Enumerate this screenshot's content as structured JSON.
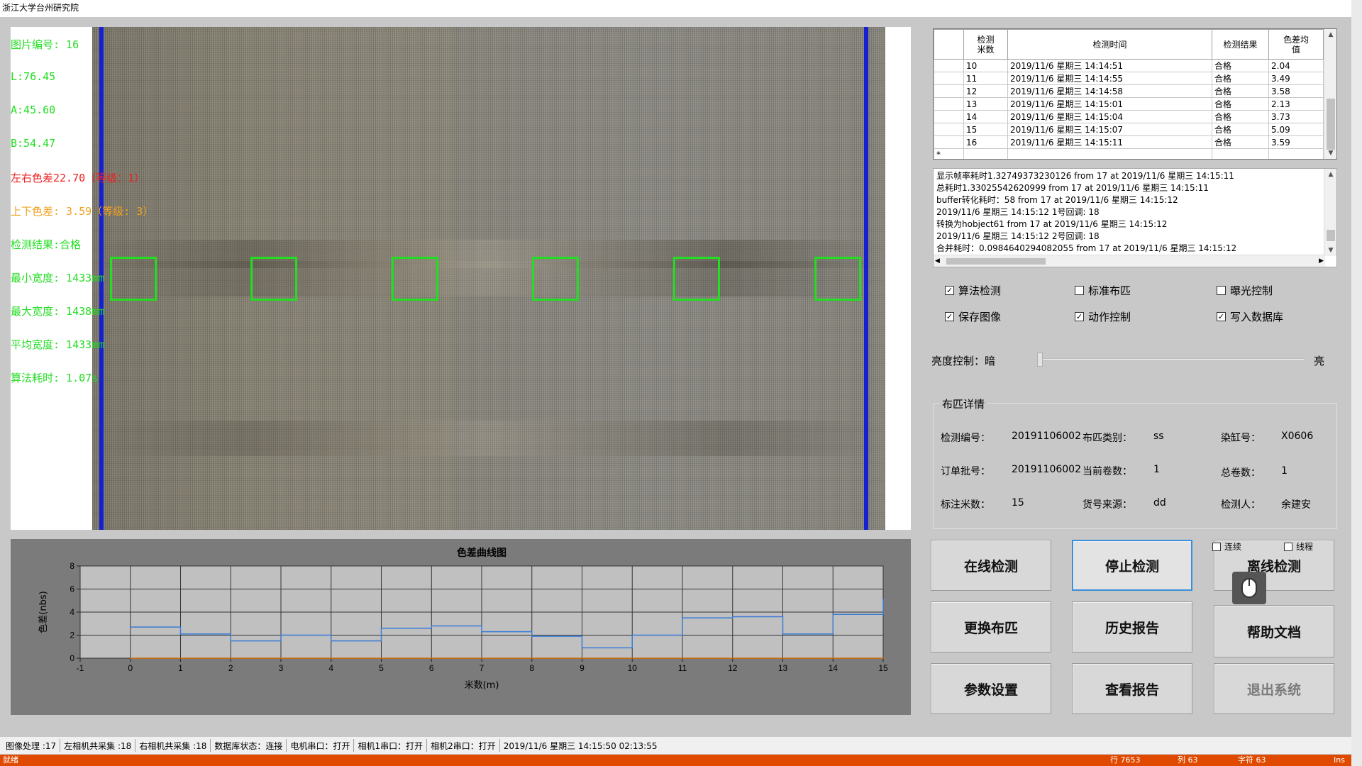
{
  "window": {
    "title": "浙江大学台州研究院"
  },
  "overlay": {
    "lines": [
      {
        "text": "图片编号: 16",
        "color": "#22dd22"
      },
      {
        "text": "L:76.45",
        "color": "#22dd22"
      },
      {
        "text": "A:45.60",
        "color": "#22dd22"
      },
      {
        "text": "B:54.47",
        "color": "#22dd22"
      },
      {
        "text": "左右色差22.70（等级：1）",
        "color": "#ee2222"
      },
      {
        "text": "上下色差: 3.59（等级: 3）",
        "color": "#f0a020"
      },
      {
        "text": "检测结果:合格",
        "color": "#22dd22"
      },
      {
        "text": "最小宽度: 1433mm",
        "color": "#22dd22"
      },
      {
        "text": "最大宽度: 1438mm",
        "color": "#22dd22"
      },
      {
        "text": "平均宽度: 1433mm",
        "color": "#22dd22"
      },
      {
        "text": "算法耗时: 1.07s",
        "color": "#22dd22"
      }
    ]
  },
  "chart_data": {
    "type": "line",
    "title": "色差曲线图",
    "xlabel": "米数(m)",
    "ylabel": "色差(nbs)",
    "xlim": [
      -1,
      15
    ],
    "ylim": [
      0,
      8
    ],
    "xticks": [
      "-1",
      "0",
      "1",
      "2",
      "3",
      "4",
      "5",
      "6",
      "7",
      "8",
      "9",
      "10",
      "11",
      "12",
      "13",
      "14",
      "15"
    ],
    "yticks": [
      "0",
      "2",
      "4",
      "6",
      "8"
    ],
    "grid": true,
    "series": [
      {
        "color": "#3a7bd5",
        "step": true,
        "x": [
          0,
          1,
          2,
          3,
          4,
          5,
          6,
          7,
          8,
          9,
          10,
          11,
          12,
          13,
          14,
          15
        ],
        "values": [
          2.7,
          2.1,
          1.5,
          2.0,
          1.5,
          2.6,
          2.8,
          2.3,
          1.9,
          0.9,
          2.0,
          3.5,
          3.6,
          2.1,
          3.8,
          5.1
        ]
      },
      {
        "color": "#d06a00",
        "step": false,
        "x": [
          0,
          15
        ],
        "values": [
          0,
          0
        ]
      }
    ]
  },
  "grid": {
    "headers": [
      "检测\n米数",
      "检测时间",
      "检测结果",
      "色差均\n值"
    ],
    "rows": [
      [
        "10",
        "2019/11/6 星期三 14:14:51",
        "合格",
        "2.04"
      ],
      [
        "11",
        "2019/11/6 星期三 14:14:55",
        "合格",
        "3.49"
      ],
      [
        "12",
        "2019/11/6 星期三 14:14:58",
        "合格",
        "3.58"
      ],
      [
        "13",
        "2019/11/6 星期三 14:15:01",
        "合格",
        "2.13"
      ],
      [
        "14",
        "2019/11/6 星期三 14:15:04",
        "合格",
        "3.73"
      ],
      [
        "15",
        "2019/11/6 星期三 14:15:07",
        "合格",
        "5.09"
      ],
      [
        "16",
        "2019/11/6 星期三 14:15:11",
        "合格",
        "3.59"
      ]
    ],
    "new_row_marker": "*"
  },
  "log": {
    "lines": [
      "显示帧率耗时1.32749373230126  from 17  at  2019/11/6 星期三 14:15:11",
      "总耗时1.33025542620999  from 17  at  2019/11/6 星期三 14:15:11",
      "buffer转化耗时：58  from 17  at  2019/11/6 星期三 14:15:12",
      "2019/11/6 星期三 14:15:12 1号回调: 18",
      "转换为hobject61  from 17  at  2019/11/6 星期三 14:15:12",
      "2019/11/6 星期三 14:15:12 2号回调: 18",
      "合并耗时：0.0984640294082055  from 17  at  2019/11/6 星期三 14:15:12"
    ]
  },
  "options": {
    "algo_detect": {
      "label": "算法检测",
      "checked": true
    },
    "std_cloth": {
      "label": "标准布匹",
      "checked": false
    },
    "exposure": {
      "label": "曝光控制",
      "checked": false
    },
    "save_image": {
      "label": "保存图像",
      "checked": true
    },
    "motion": {
      "label": "动作控制",
      "checked": true
    },
    "write_db": {
      "label": "写入数据库",
      "checked": true
    }
  },
  "brightness": {
    "label": "亮度控制：暗",
    "max_label": "亮",
    "level": 0.0
  },
  "details": {
    "legend": "布匹详情",
    "fields": {
      "detect_no_label": "检测编号：",
      "detect_no": "20191106002",
      "cloth_type_label": "布匹类别：",
      "cloth_type": "ss",
      "dye_no_label": "染缸号：",
      "dye_no": "X0606",
      "order_no_label": "订单批号：",
      "order_no": "20191106002",
      "cur_roll_label": "当前卷数：",
      "cur_roll": "1",
      "total_roll_label": "总卷数：",
      "total_roll": "1",
      "meters_label": "标注米数：",
      "meters": "15",
      "source_label": "货号来源：",
      "source": "dd",
      "inspector_label": "检测人：",
      "inspector": "余建安"
    }
  },
  "buttons": {
    "online": "在线检测",
    "stop": "停止检测",
    "offline": "离线检测",
    "change": "更换布匹",
    "history": "历史报告",
    "help": "帮助文档",
    "params": "参数设置",
    "view": "查看报告",
    "exit": "退出系统"
  },
  "small_checks": {
    "continuous": "连续",
    "thread": "线程"
  },
  "status": {
    "items": [
      "图像处理 :17",
      "左相机共采集 :18",
      "右相机共采集 :18",
      "数据库状态：连接",
      "电机串口：打开",
      "相机1串口：打开",
      "相机2串口：打开",
      "2019/11/6 星期三 14:15:50  02:13:55"
    ]
  },
  "bottom": {
    "ready": "就绪",
    "row": "行 7653",
    "col": "列 63",
    "char": "字符 63",
    "ins": "Ins"
  }
}
